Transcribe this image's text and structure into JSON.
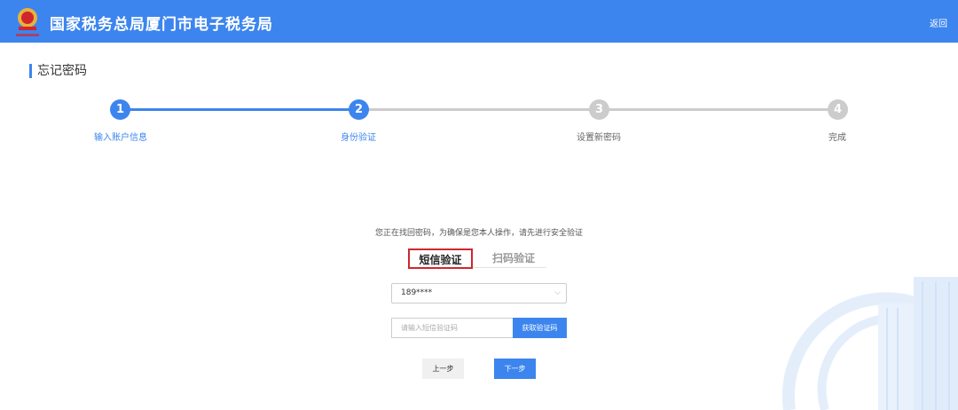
{
  "header": {
    "title": "国家税务总局厦门市电子税务局",
    "back_label": "返回"
  },
  "page_title": "忘记密码",
  "steps": [
    {
      "num": "1",
      "label": "输入账户信息",
      "state": "done"
    },
    {
      "num": "2",
      "label": "身份验证",
      "state": "active"
    },
    {
      "num": "3",
      "label": "设置新密码",
      "state": "pending"
    },
    {
      "num": "4",
      "label": "完成",
      "state": "pending"
    }
  ],
  "hint": "您正在找回密码，为确保是您本人操作，请先进行安全验证",
  "tabs": [
    {
      "label": "短信验证",
      "active": true
    },
    {
      "label": "扫码验证",
      "active": false
    }
  ],
  "phone_select": {
    "value": "189****"
  },
  "code_input": {
    "placeholder": "请输入短信验证码",
    "button": "获取验证码"
  },
  "buttons": {
    "prev": "上一步",
    "next": "下一步"
  },
  "colors": {
    "primary": "#3d85ee",
    "inactive": "#cccccc",
    "tab_border": "#d0262e"
  }
}
